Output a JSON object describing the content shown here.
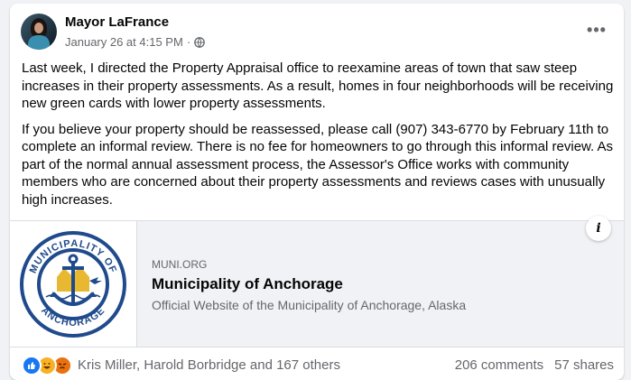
{
  "post": {
    "author": "Mayor LaFrance",
    "date": "January 26 at 4:15 PM",
    "separator": "·",
    "audience_icon": "globe-icon",
    "more_icon": "ellipsis-icon",
    "paragraphs": [
      "Last week, I directed the Property Appraisal office to reexamine areas of town that saw steep increases in their property assessments. As a result, homes in four neighborhoods will be receiving new green cards with lower property assessments.",
      "If you believe your property should be reassessed, please call (907) 343-6770 by February 11th to complete an informal review. There is no fee for homeowners to go through this informal review. As part of the normal annual assessment process, the Assessor's Office works with community members who are concerned about their property assessments and reviews cases with unusually high increases."
    ]
  },
  "link_preview": {
    "domain": "MUNI.ORG",
    "title": "Municipality of Anchorage",
    "description": "Official Website of the Municipality of Anchorage, Alaska",
    "info_label": "i",
    "logo": {
      "top_text": "MUNICIPALITY OF",
      "bottom_text": "ANCHORAGE"
    }
  },
  "footer": {
    "reactions": [
      "like-icon",
      "haha-icon",
      "angry-icon"
    ],
    "reactors": "Kris Miller, Harold Borbridge and 167 others",
    "comments": "206 comments",
    "shares": "57 shares"
  },
  "colors": {
    "brand_blue": "#1877f2",
    "muted": "#65676b",
    "logo_blue": "#1f4a8c",
    "logo_gold": "#e8b930"
  }
}
